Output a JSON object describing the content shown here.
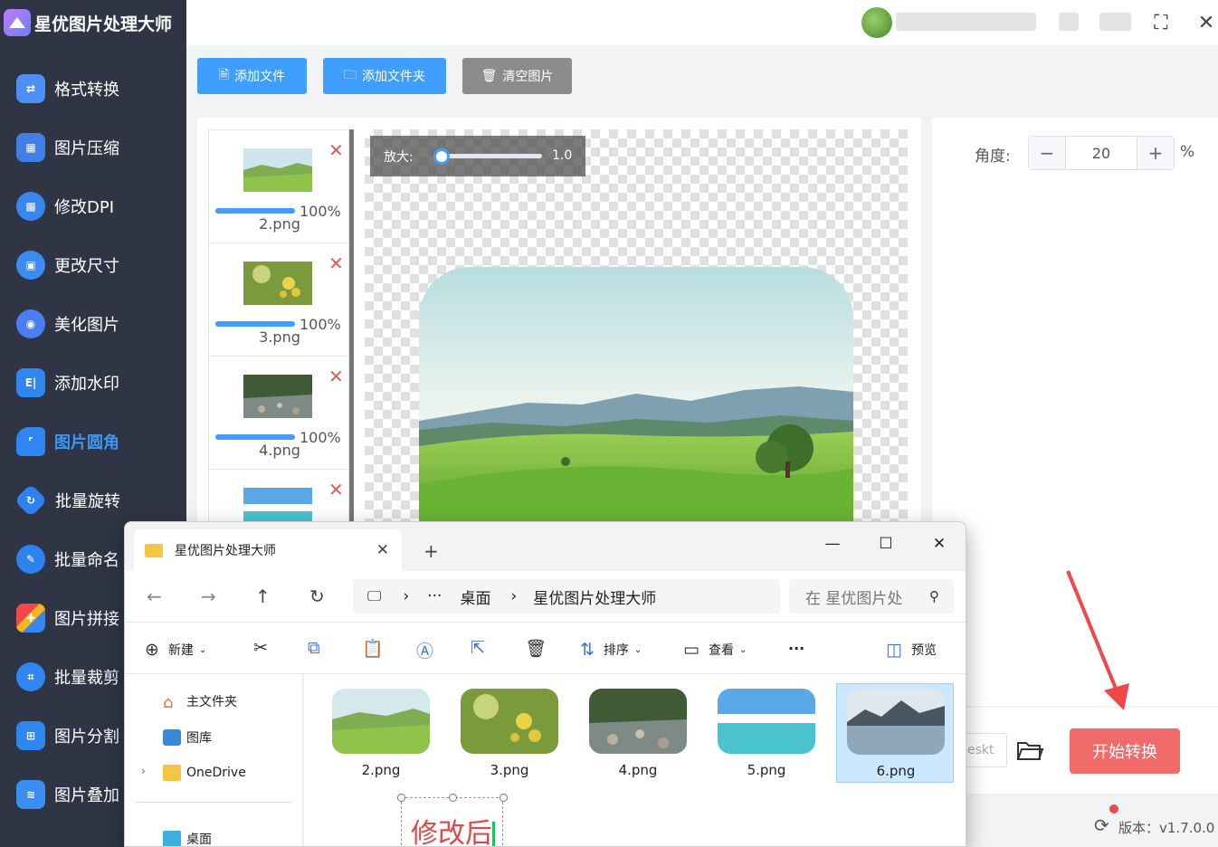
{
  "app": {
    "title": "星优图片处理大师",
    "version": "版本：v1.7.0.0"
  },
  "sidebar": {
    "items": [
      {
        "label": "格式转换",
        "icon": "format-convert-icon"
      },
      {
        "label": "图片压缩",
        "icon": "compress-icon"
      },
      {
        "label": "修改DPI",
        "icon": "dpi-icon"
      },
      {
        "label": "更改尺寸",
        "icon": "resize-icon"
      },
      {
        "label": "美化图片",
        "icon": "beautify-icon"
      },
      {
        "label": "添加水印",
        "icon": "watermark-icon"
      },
      {
        "label": "图片圆角",
        "icon": "round-corner-icon",
        "active": true
      },
      {
        "label": "批量旋转",
        "icon": "rotate-icon"
      },
      {
        "label": "批量命名",
        "icon": "rename-icon"
      },
      {
        "label": "图片拼接",
        "icon": "puzzle-icon"
      },
      {
        "label": "批量裁剪",
        "icon": "crop-icon"
      },
      {
        "label": "图片分割",
        "icon": "split-icon"
      },
      {
        "label": "图片叠加",
        "icon": "layers-icon"
      }
    ]
  },
  "toolbar": {
    "add_file": "添加文件",
    "add_folder": "添加文件夹",
    "clear": "清空图片"
  },
  "files": [
    {
      "name": "2.png",
      "progress": "100%",
      "progress_value": 100
    },
    {
      "name": "3.png",
      "progress": "100%",
      "progress_value": 100
    },
    {
      "name": "4.png",
      "progress": "100%",
      "progress_value": 100
    },
    {
      "name": "5.png",
      "progress": "",
      "progress_value": 0
    }
  ],
  "zoom": {
    "label": "放大:",
    "value": "1.0"
  },
  "settings": {
    "angle_label": "角度:",
    "angle_value": "20",
    "unit": "%",
    "minus": "−",
    "plus": "+"
  },
  "output": {
    "path_fragment": "eskt",
    "start_button": "开始转换"
  },
  "explorer": {
    "tab_title": "星优图片处理大师",
    "breadcrumb": {
      "ellipsis": "···",
      "desktop": "桌面",
      "folder": "星优图片处理大师"
    },
    "search_placeholder": "在 星优图片处",
    "commands": {
      "new": "新建",
      "sort": "排序",
      "view": "查看",
      "more": "···",
      "preview": "预览"
    },
    "side_items": [
      "主文件夹",
      "图库",
      "OneDrive",
      "桌面"
    ],
    "files": [
      {
        "name": "2.png",
        "selected": false
      },
      {
        "name": "3.png",
        "selected": false
      },
      {
        "name": "4.png",
        "selected": false
      },
      {
        "name": "5.png",
        "selected": false
      },
      {
        "name": "6.png",
        "selected": true
      }
    ]
  },
  "annotation": {
    "text": "修改后"
  },
  "colors": {
    "sidebar_bg": "#2f3545",
    "accent": "#409eff",
    "active_nav": "#3a98f5",
    "start_button": "#f26b6b",
    "clear_button": "#8c8c8c",
    "arrow": "#f04848"
  }
}
